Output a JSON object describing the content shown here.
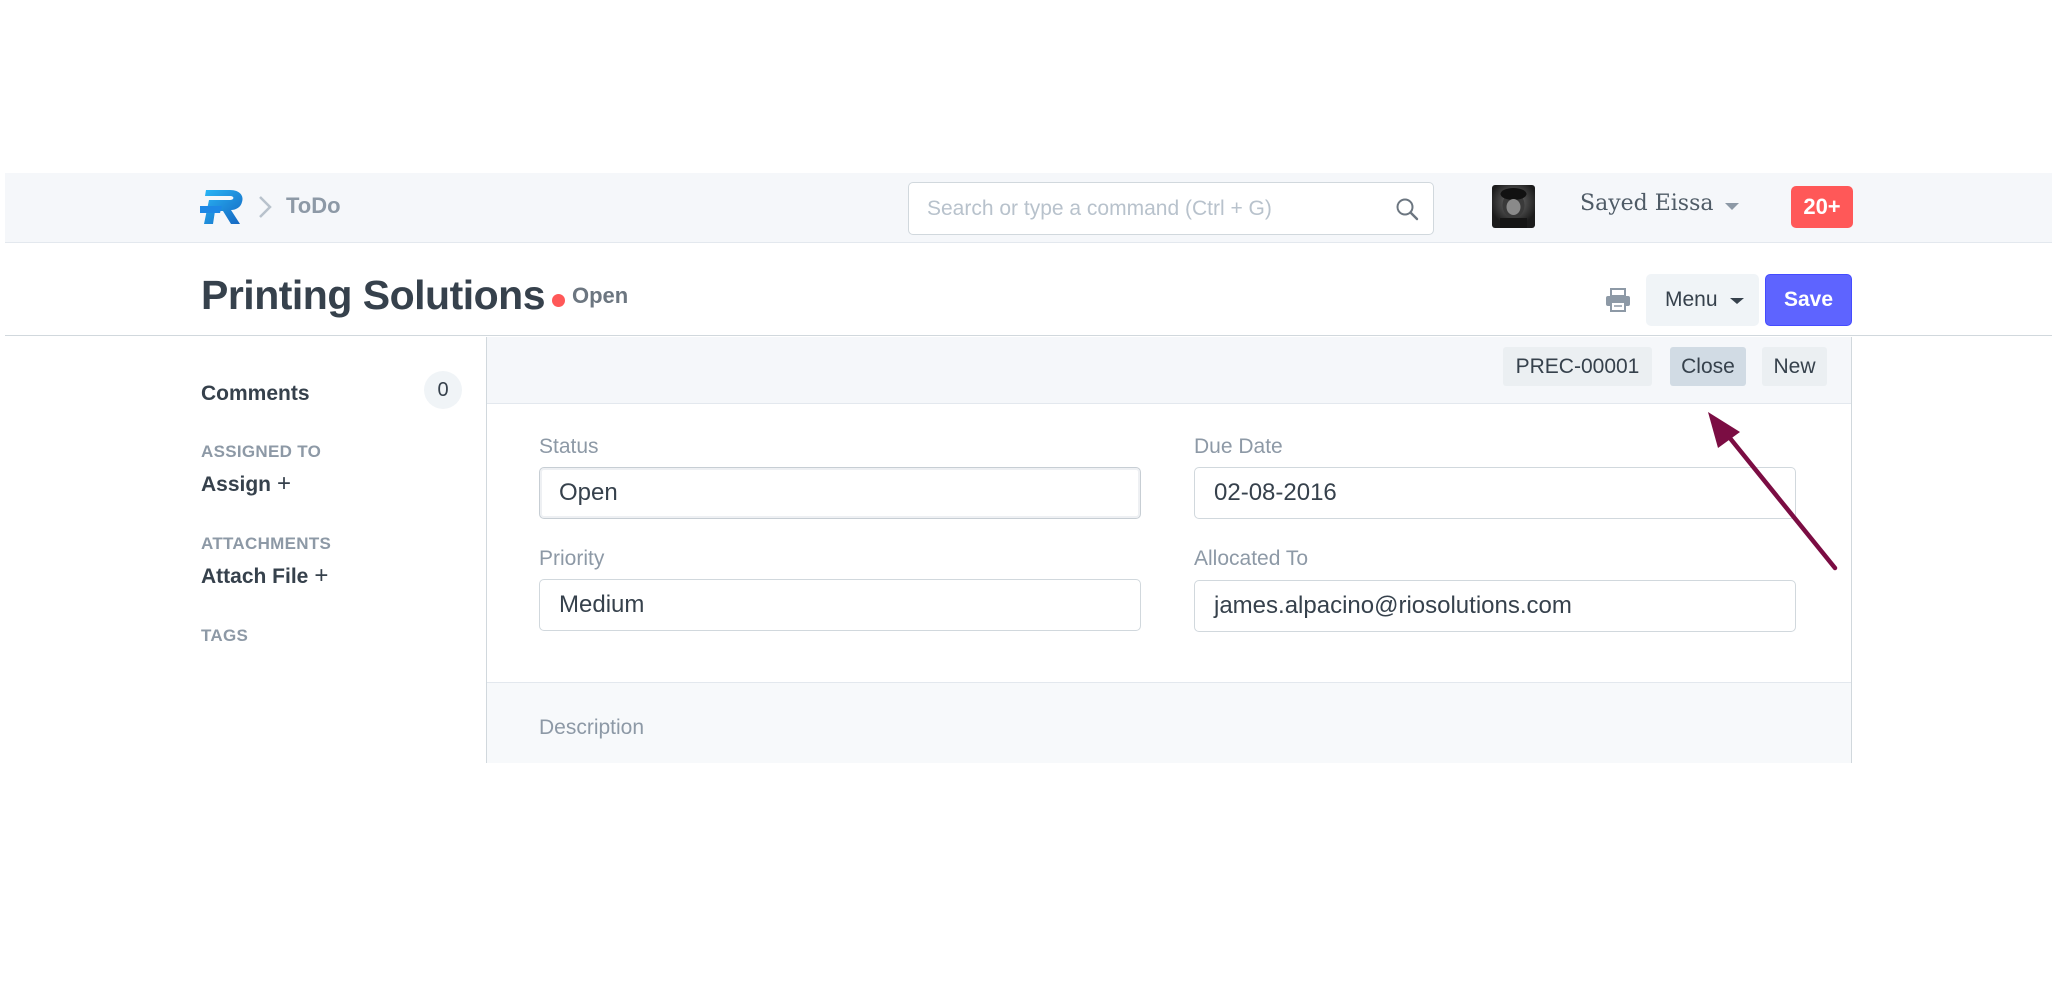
{
  "navbar": {
    "breadcrumb_label": "ToDo",
    "search_placeholder": "Search or type a command (Ctrl + G)",
    "user_name": "Sayed Eissa",
    "notification_count": "20+"
  },
  "page": {
    "title": "Printing Solutions",
    "status": "Open",
    "status_color": "#ff5858",
    "menu_label": "Menu",
    "save_label": "Save",
    "accent_color": "#5e64ff"
  },
  "sidebar": {
    "comments_label": "Comments",
    "comments_count": "0",
    "assigned_heading": "ASSIGNED TO",
    "assign_label": "Assign",
    "attachments_heading": "ATTACHMENTS",
    "attach_label": "Attach File",
    "plus": "+",
    "tags_heading": "TAGS"
  },
  "toolbar": {
    "doc_id": "PREC-00001",
    "close_label": "Close",
    "new_label": "New"
  },
  "form": {
    "status_label": "Status",
    "status_value": "Open",
    "due_date_label": "Due Date",
    "due_date_value": "02-08-2016",
    "priority_label": "Priority",
    "priority_value": "Medium",
    "allocated_label": "Allocated To",
    "allocated_value": "james.alpacino@riosolutions.com",
    "description_label": "Description"
  },
  "annotation": {
    "arrow_color": "#7b0d43"
  }
}
